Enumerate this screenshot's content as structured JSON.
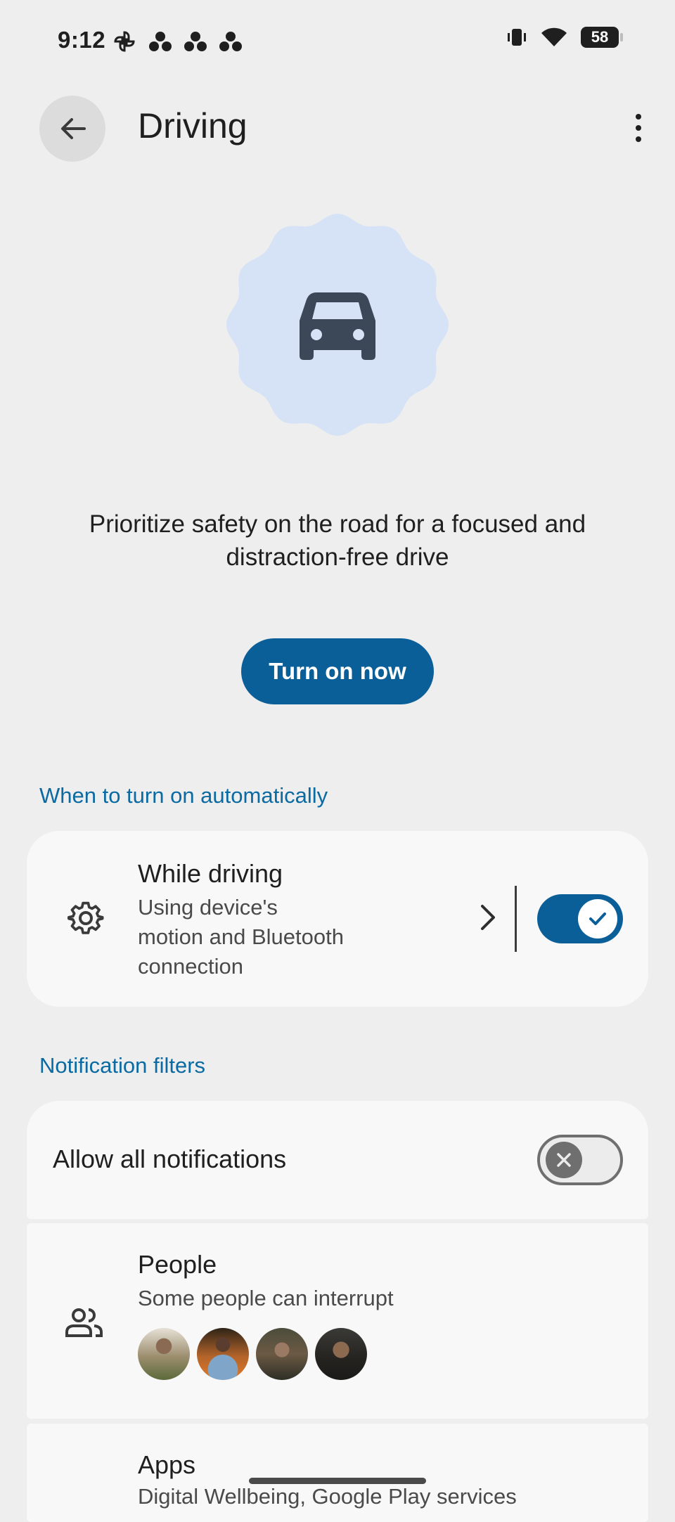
{
  "status_bar": {
    "time": "9:12",
    "battery": "58",
    "left_icons": [
      "pinwheel-icon",
      "dots-icon",
      "dots-icon",
      "dots-icon"
    ],
    "right_icons": [
      "vibrate-icon",
      "wifi-icon",
      "battery-icon"
    ]
  },
  "header": {
    "title": "Driving",
    "back_icon": "arrow-back-icon",
    "menu_icon": "more-vert-icon"
  },
  "hero": {
    "icon": "car-icon",
    "description": "Prioritize safety on the road for a focused and distraction-free drive",
    "button_label": "Turn on now"
  },
  "automatic": {
    "section_title": "When to turn on automatically",
    "item": {
      "title": "While driving",
      "subtitle_lines": [
        "Using device's",
        "motion and Bluetooth",
        "connection"
      ],
      "enabled": true
    }
  },
  "notification_filters": {
    "section_title": "Notification filters",
    "allow_all": {
      "label": "Allow all notifications",
      "enabled": false
    },
    "people": {
      "title": "People",
      "subtitle": "Some people can interrupt"
    },
    "apps": {
      "title": "Apps",
      "subtitle": "Digital Wellbeing, Google Play services"
    }
  },
  "colors": {
    "accent": "#0b5f99",
    "section_text": "#0b6aa2",
    "hero_blob": "#d6e3f6",
    "background": "#eeeeee",
    "card": "#f8f8f8"
  }
}
